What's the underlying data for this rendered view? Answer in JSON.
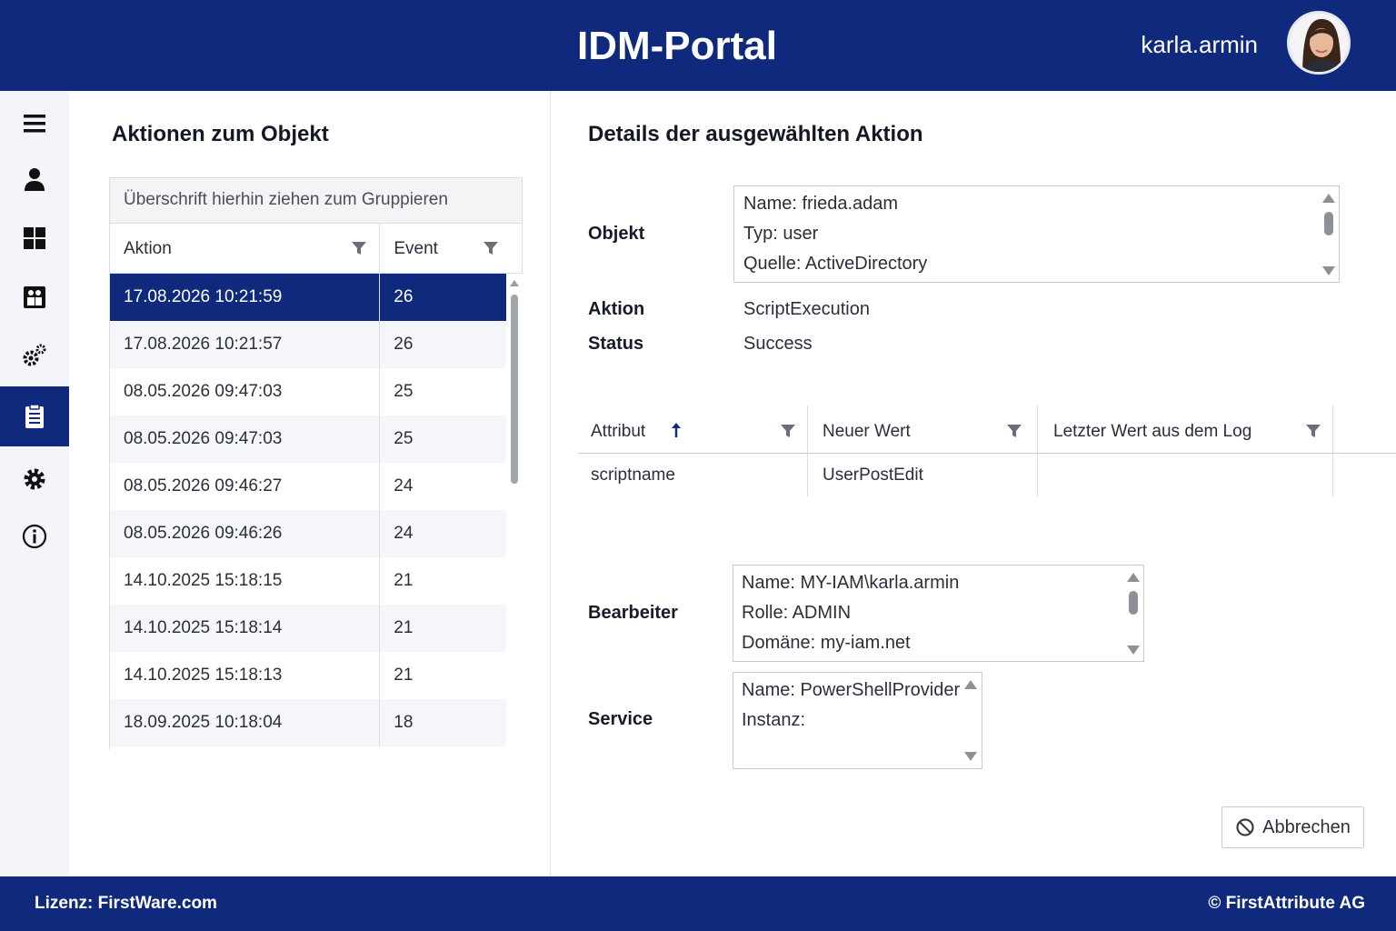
{
  "header": {
    "title": "IDM-Portal",
    "username": "karla.armin"
  },
  "sidebar": {
    "items": [
      {
        "icon": "menu-icon",
        "active": false
      },
      {
        "icon": "user-icon",
        "active": false
      },
      {
        "icon": "dashboard-icon",
        "active": false
      },
      {
        "icon": "groups-icon",
        "active": false
      },
      {
        "icon": "gears-icon",
        "active": false
      },
      {
        "icon": "clipboard-icon",
        "active": true
      },
      {
        "icon": "settings-icon",
        "active": false
      },
      {
        "icon": "info-icon",
        "active": false
      }
    ]
  },
  "left_panel": {
    "title": "Aktionen zum Objekt",
    "group_placeholder": "Überschrift hierhin ziehen zum Gruppieren",
    "columns": [
      "Aktion",
      "Event"
    ],
    "rows": [
      {
        "aktion": "17.08.2026 10:21:59",
        "event": "26",
        "selected": true
      },
      {
        "aktion": "17.08.2026 10:21:57",
        "event": "26"
      },
      {
        "aktion": "08.05.2026 09:47:03",
        "event": "25"
      },
      {
        "aktion": "08.05.2026 09:47:03",
        "event": "25"
      },
      {
        "aktion": "08.05.2026 09:46:27",
        "event": "24"
      },
      {
        "aktion": "08.05.2026 09:46:26",
        "event": "24"
      },
      {
        "aktion": "14.10.2025 15:18:15",
        "event": "21"
      },
      {
        "aktion": "14.10.2025 15:18:14",
        "event": "21"
      },
      {
        "aktion": "14.10.2025 15:18:13",
        "event": "21"
      },
      {
        "aktion": "18.09.2025 10:18:04",
        "event": "18"
      }
    ]
  },
  "details": {
    "title": "Details der ausgewählten Aktion",
    "objekt_label": "Objekt",
    "objekt_lines": [
      "Name: frieda.adam",
      "Typ: user",
      "Quelle: ActiveDirectory"
    ],
    "aktion_label": "Aktion",
    "aktion_value": "ScriptExecution",
    "status_label": "Status",
    "status_value": "Success",
    "attr_columns": [
      "Attribut",
      "Neuer Wert",
      "Letzter Wert aus dem Log"
    ],
    "attr_rows": [
      {
        "attribut": "scriptname",
        "neuer_wert": "UserPostEdit",
        "letzter_wert": ""
      }
    ],
    "bearbeiter_label": "Bearbeiter",
    "bearbeiter_lines": [
      "Name: MY-IAM\\karla.armin",
      "Rolle: ADMIN",
      "Domäne: my-iam.net"
    ],
    "service_label": "Service",
    "service_lines": [
      "Name: PowerShellProvider",
      "Instanz:"
    ],
    "cancel_label": "Abbrechen"
  },
  "footer": {
    "license": "Lizenz: FirstWare.com",
    "copyright": "© FirstAttribute AG"
  },
  "colors": {
    "brand": "#0f2a7d",
    "selected_row": "#0f2a7d"
  }
}
